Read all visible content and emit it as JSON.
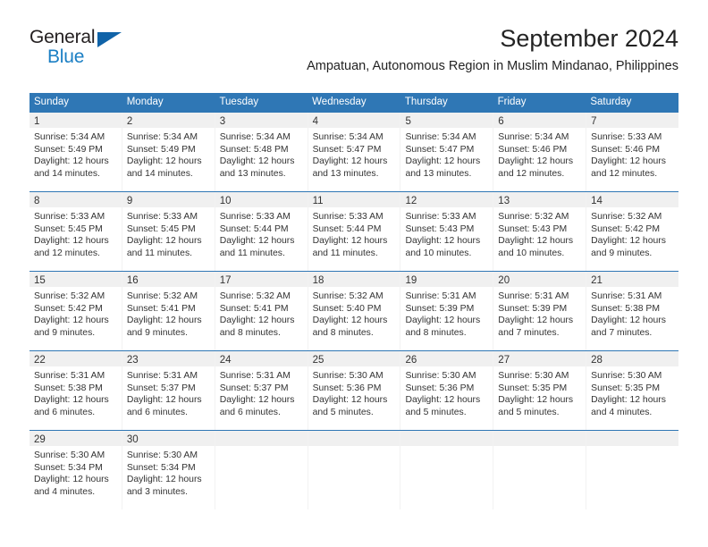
{
  "brand": {
    "name_part1": "General",
    "name_part2": "Blue",
    "triangle_color": "#1063a8",
    "blue_color": "#1b7fc4"
  },
  "header": {
    "title": "September 2024",
    "subtitle": "Ampatuan, Autonomous Region in Muslim Mindanao, Philippines"
  },
  "theme": {
    "header_blue": "#2f77b5",
    "day_band_gray": "#f0f0f0",
    "text_color": "#333333"
  },
  "weekdays": [
    "Sunday",
    "Monday",
    "Tuesday",
    "Wednesday",
    "Thursday",
    "Friday",
    "Saturday"
  ],
  "weeks": [
    [
      {
        "day": "1",
        "sunrise": "Sunrise: 5:34 AM",
        "sunset": "Sunset: 5:49 PM",
        "daylight1": "Daylight: 12 hours",
        "daylight2": "and 14 minutes."
      },
      {
        "day": "2",
        "sunrise": "Sunrise: 5:34 AM",
        "sunset": "Sunset: 5:49 PM",
        "daylight1": "Daylight: 12 hours",
        "daylight2": "and 14 minutes."
      },
      {
        "day": "3",
        "sunrise": "Sunrise: 5:34 AM",
        "sunset": "Sunset: 5:48 PM",
        "daylight1": "Daylight: 12 hours",
        "daylight2": "and 13 minutes."
      },
      {
        "day": "4",
        "sunrise": "Sunrise: 5:34 AM",
        "sunset": "Sunset: 5:47 PM",
        "daylight1": "Daylight: 12 hours",
        "daylight2": "and 13 minutes."
      },
      {
        "day": "5",
        "sunrise": "Sunrise: 5:34 AM",
        "sunset": "Sunset: 5:47 PM",
        "daylight1": "Daylight: 12 hours",
        "daylight2": "and 13 minutes."
      },
      {
        "day": "6",
        "sunrise": "Sunrise: 5:34 AM",
        "sunset": "Sunset: 5:46 PM",
        "daylight1": "Daylight: 12 hours",
        "daylight2": "and 12 minutes."
      },
      {
        "day": "7",
        "sunrise": "Sunrise: 5:33 AM",
        "sunset": "Sunset: 5:46 PM",
        "daylight1": "Daylight: 12 hours",
        "daylight2": "and 12 minutes."
      }
    ],
    [
      {
        "day": "8",
        "sunrise": "Sunrise: 5:33 AM",
        "sunset": "Sunset: 5:45 PM",
        "daylight1": "Daylight: 12 hours",
        "daylight2": "and 12 minutes."
      },
      {
        "day": "9",
        "sunrise": "Sunrise: 5:33 AM",
        "sunset": "Sunset: 5:45 PM",
        "daylight1": "Daylight: 12 hours",
        "daylight2": "and 11 minutes."
      },
      {
        "day": "10",
        "sunrise": "Sunrise: 5:33 AM",
        "sunset": "Sunset: 5:44 PM",
        "daylight1": "Daylight: 12 hours",
        "daylight2": "and 11 minutes."
      },
      {
        "day": "11",
        "sunrise": "Sunrise: 5:33 AM",
        "sunset": "Sunset: 5:44 PM",
        "daylight1": "Daylight: 12 hours",
        "daylight2": "and 11 minutes."
      },
      {
        "day": "12",
        "sunrise": "Sunrise: 5:33 AM",
        "sunset": "Sunset: 5:43 PM",
        "daylight1": "Daylight: 12 hours",
        "daylight2": "and 10 minutes."
      },
      {
        "day": "13",
        "sunrise": "Sunrise: 5:32 AM",
        "sunset": "Sunset: 5:43 PM",
        "daylight1": "Daylight: 12 hours",
        "daylight2": "and 10 minutes."
      },
      {
        "day": "14",
        "sunrise": "Sunrise: 5:32 AM",
        "sunset": "Sunset: 5:42 PM",
        "daylight1": "Daylight: 12 hours",
        "daylight2": "and 9 minutes."
      }
    ],
    [
      {
        "day": "15",
        "sunrise": "Sunrise: 5:32 AM",
        "sunset": "Sunset: 5:42 PM",
        "daylight1": "Daylight: 12 hours",
        "daylight2": "and 9 minutes."
      },
      {
        "day": "16",
        "sunrise": "Sunrise: 5:32 AM",
        "sunset": "Sunset: 5:41 PM",
        "daylight1": "Daylight: 12 hours",
        "daylight2": "and 9 minutes."
      },
      {
        "day": "17",
        "sunrise": "Sunrise: 5:32 AM",
        "sunset": "Sunset: 5:41 PM",
        "daylight1": "Daylight: 12 hours",
        "daylight2": "and 8 minutes."
      },
      {
        "day": "18",
        "sunrise": "Sunrise: 5:32 AM",
        "sunset": "Sunset: 5:40 PM",
        "daylight1": "Daylight: 12 hours",
        "daylight2": "and 8 minutes."
      },
      {
        "day": "19",
        "sunrise": "Sunrise: 5:31 AM",
        "sunset": "Sunset: 5:39 PM",
        "daylight1": "Daylight: 12 hours",
        "daylight2": "and 8 minutes."
      },
      {
        "day": "20",
        "sunrise": "Sunrise: 5:31 AM",
        "sunset": "Sunset: 5:39 PM",
        "daylight1": "Daylight: 12 hours",
        "daylight2": "and 7 minutes."
      },
      {
        "day": "21",
        "sunrise": "Sunrise: 5:31 AM",
        "sunset": "Sunset: 5:38 PM",
        "daylight1": "Daylight: 12 hours",
        "daylight2": "and 7 minutes."
      }
    ],
    [
      {
        "day": "22",
        "sunrise": "Sunrise: 5:31 AM",
        "sunset": "Sunset: 5:38 PM",
        "daylight1": "Daylight: 12 hours",
        "daylight2": "and 6 minutes."
      },
      {
        "day": "23",
        "sunrise": "Sunrise: 5:31 AM",
        "sunset": "Sunset: 5:37 PM",
        "daylight1": "Daylight: 12 hours",
        "daylight2": "and 6 minutes."
      },
      {
        "day": "24",
        "sunrise": "Sunrise: 5:31 AM",
        "sunset": "Sunset: 5:37 PM",
        "daylight1": "Daylight: 12 hours",
        "daylight2": "and 6 minutes."
      },
      {
        "day": "25",
        "sunrise": "Sunrise: 5:30 AM",
        "sunset": "Sunset: 5:36 PM",
        "daylight1": "Daylight: 12 hours",
        "daylight2": "and 5 minutes."
      },
      {
        "day": "26",
        "sunrise": "Sunrise: 5:30 AM",
        "sunset": "Sunset: 5:36 PM",
        "daylight1": "Daylight: 12 hours",
        "daylight2": "and 5 minutes."
      },
      {
        "day": "27",
        "sunrise": "Sunrise: 5:30 AM",
        "sunset": "Sunset: 5:35 PM",
        "daylight1": "Daylight: 12 hours",
        "daylight2": "and 5 minutes."
      },
      {
        "day": "28",
        "sunrise": "Sunrise: 5:30 AM",
        "sunset": "Sunset: 5:35 PM",
        "daylight1": "Daylight: 12 hours",
        "daylight2": "and 4 minutes."
      }
    ],
    [
      {
        "day": "29",
        "sunrise": "Sunrise: 5:30 AM",
        "sunset": "Sunset: 5:34 PM",
        "daylight1": "Daylight: 12 hours",
        "daylight2": "and 4 minutes."
      },
      {
        "day": "30",
        "sunrise": "Sunrise: 5:30 AM",
        "sunset": "Sunset: 5:34 PM",
        "daylight1": "Daylight: 12 hours",
        "daylight2": "and 3 minutes."
      },
      {
        "day": "",
        "sunrise": "",
        "sunset": "",
        "daylight1": "",
        "daylight2": ""
      },
      {
        "day": "",
        "sunrise": "",
        "sunset": "",
        "daylight1": "",
        "daylight2": ""
      },
      {
        "day": "",
        "sunrise": "",
        "sunset": "",
        "daylight1": "",
        "daylight2": ""
      },
      {
        "day": "",
        "sunrise": "",
        "sunset": "",
        "daylight1": "",
        "daylight2": ""
      },
      {
        "day": "",
        "sunrise": "",
        "sunset": "",
        "daylight1": "",
        "daylight2": ""
      }
    ]
  ]
}
